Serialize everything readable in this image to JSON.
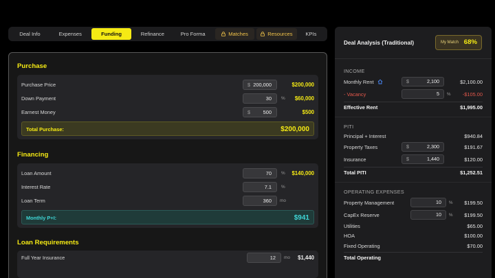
{
  "tabs": [
    {
      "label": "Deal Info",
      "state": "normal"
    },
    {
      "label": "Expenses",
      "state": "normal"
    },
    {
      "label": "Funding",
      "state": "active"
    },
    {
      "label": "Refinance",
      "state": "normal"
    },
    {
      "label": "Pro Forma",
      "state": "normal"
    },
    {
      "label": "Matches",
      "state": "locked"
    },
    {
      "label": "Resources",
      "state": "locked"
    },
    {
      "label": "KPIs",
      "state": "normal"
    }
  ],
  "purchase": {
    "title": "Purchase",
    "price": {
      "label": "Purchase Price",
      "input": "200,000",
      "value": "$200,000"
    },
    "down": {
      "label": "Down Payment",
      "input": "30",
      "unit": "%",
      "value": "$60,000"
    },
    "earnest": {
      "label": "Earnest Money",
      "input": "500",
      "value": "$500"
    },
    "total": {
      "label": "Total Purchase:",
      "value": "$200,000"
    }
  },
  "financing": {
    "title": "Financing",
    "loan_amount": {
      "label": "Loan Amount",
      "input": "70",
      "unit": "%",
      "value": "$140,000"
    },
    "rate": {
      "label": "Interest Rate",
      "input": "7.1",
      "unit": "%"
    },
    "term": {
      "label": "Loan Term",
      "input": "360",
      "unit": "mo"
    },
    "monthly": {
      "label": "Monthly P+I:",
      "value": "$941"
    }
  },
  "requirements": {
    "title": "Loan Requirements",
    "insurance": {
      "label": "Full Year Insurance",
      "input": "12",
      "unit": "mo",
      "value": "$1,440"
    }
  },
  "analysis": {
    "title": "Deal Analysis (Traditional)",
    "match_label": "My Match",
    "match_value": "68%",
    "income": {
      "title": "INCOME",
      "rent": {
        "label": "Monthly Rent",
        "input": "2,100",
        "value": "$2,100.00"
      },
      "vacancy": {
        "label": "- Vacancy",
        "input": "5",
        "unit": "%",
        "value": "-$105.00"
      },
      "effective": {
        "label": "Effective Rent",
        "value": "$1,995.00"
      }
    },
    "piti": {
      "title": "PITI",
      "pi": {
        "label": "Principal + Interest",
        "value": "$940.84"
      },
      "taxes": {
        "label": "Property Taxes",
        "input": "2,300",
        "value": "$191.67"
      },
      "insurance": {
        "label": "Insurance",
        "input": "1,440",
        "value": "$120.00"
      },
      "total": {
        "label": "Total PITI",
        "value": "$1,252.51"
      }
    },
    "opex": {
      "title": "OPERATING EXPENSES",
      "mgmt": {
        "label": "Property Management",
        "input": "10",
        "unit": "%",
        "value": "$199.50"
      },
      "capex": {
        "label": "CapEx Reserve",
        "input": "10",
        "unit": "%",
        "value": "$199.50"
      },
      "utilities": {
        "label": "Utilities",
        "value": "$65.00"
      },
      "hoa": {
        "label": "HOA",
        "value": "$100.00"
      },
      "fixed": {
        "label": "Fixed Operating",
        "value": "$70.00"
      },
      "total": {
        "label": "Total Operating"
      }
    }
  },
  "colors": {
    "accent": "#f5ea14",
    "teal": "#3fd6d6",
    "negative": "#e4584b"
  },
  "icons": {
    "lock": "lock-icon",
    "home": "home-icon"
  }
}
